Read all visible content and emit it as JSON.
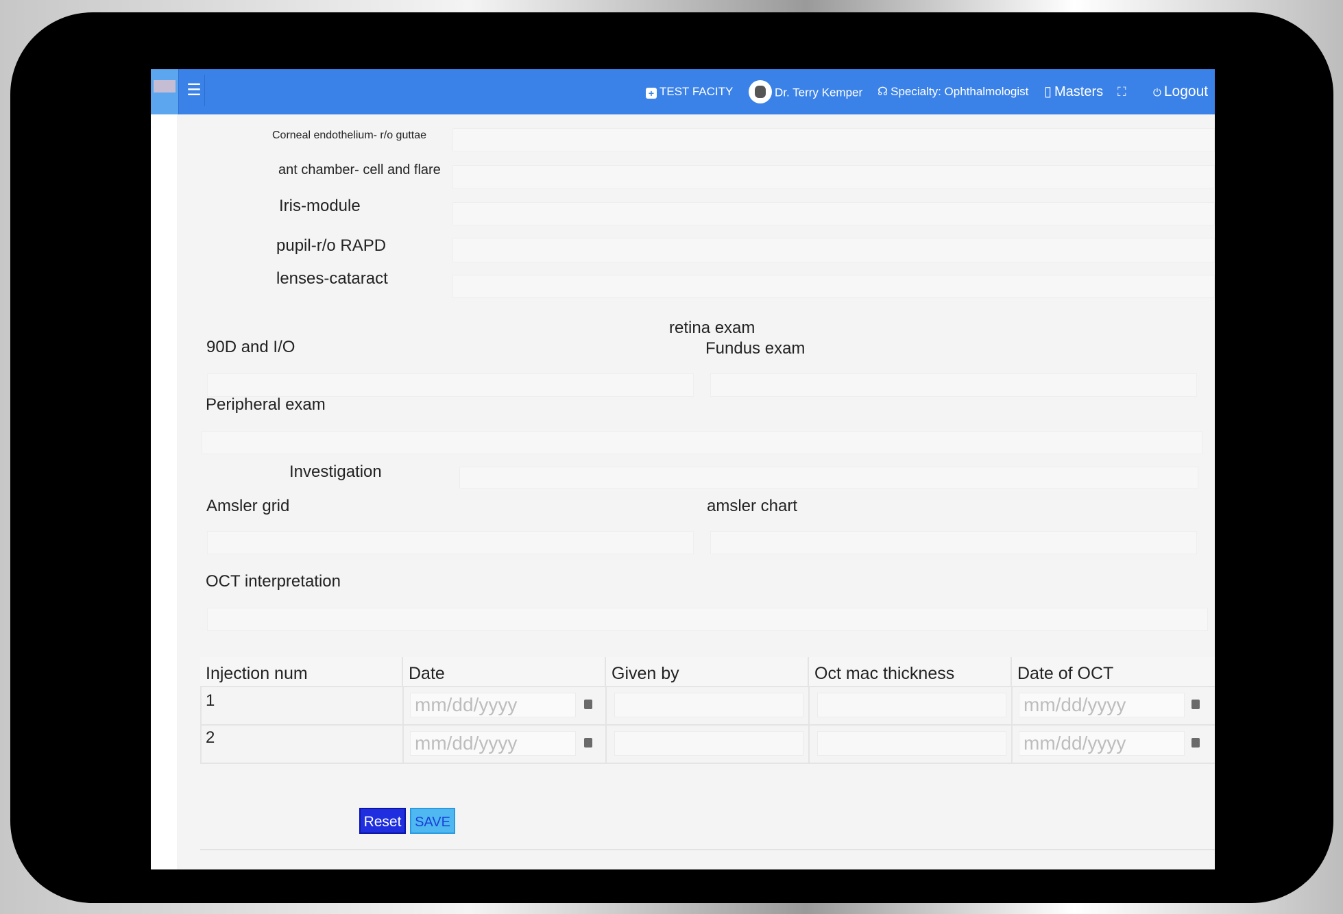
{
  "topbar": {
    "facility": "TEST FACITY",
    "doctor": "Dr. Terry Kemper",
    "specialty": "Specialty: Ophthalmologist",
    "masters": "Masters",
    "logout": "Logout"
  },
  "anterior": {
    "corneal_endothelium": "Corneal endothelium- r/o guttae",
    "ant_chamber": "ant chamber- cell and flare",
    "iris": "Iris-module",
    "pupil": "pupil-r/o RAPD",
    "lenses": "lenses-cataract"
  },
  "retina": {
    "heading": "retina exam",
    "d90": "90D and I/O",
    "fundus": "Fundus exam",
    "peripheral": "Peripheral exam"
  },
  "investigation": {
    "label": "Investigation",
    "amsler_grid": "Amsler grid",
    "amsler_chart": "amsler chart",
    "oct_interpretation": "OCT interpretation"
  },
  "injections": {
    "columns": [
      "Injection num",
      "Date",
      "Given by",
      "Oct mac thickness",
      "Date of OCT"
    ],
    "rows": [
      {
        "num": "1",
        "date_placeholder": "mm/dd/yyyy",
        "oct_date_placeholder": "mm/dd/yyyy"
      },
      {
        "num": "2",
        "date_placeholder": "mm/dd/yyyy",
        "oct_date_placeholder": "mm/dd/yyyy"
      }
    ]
  },
  "actions": {
    "reset": "Reset",
    "save": "SAVE"
  },
  "colors": {
    "topbar": "#3b82e8",
    "reset": "#1f2fe0",
    "save": "#4fb8f0"
  },
  "icons": [
    "menu-icon",
    "hospital-icon",
    "user-avatar-icon",
    "stethoscope-icon",
    "mobile-icon",
    "expand-icon",
    "power-icon",
    "calendar-icon"
  ]
}
